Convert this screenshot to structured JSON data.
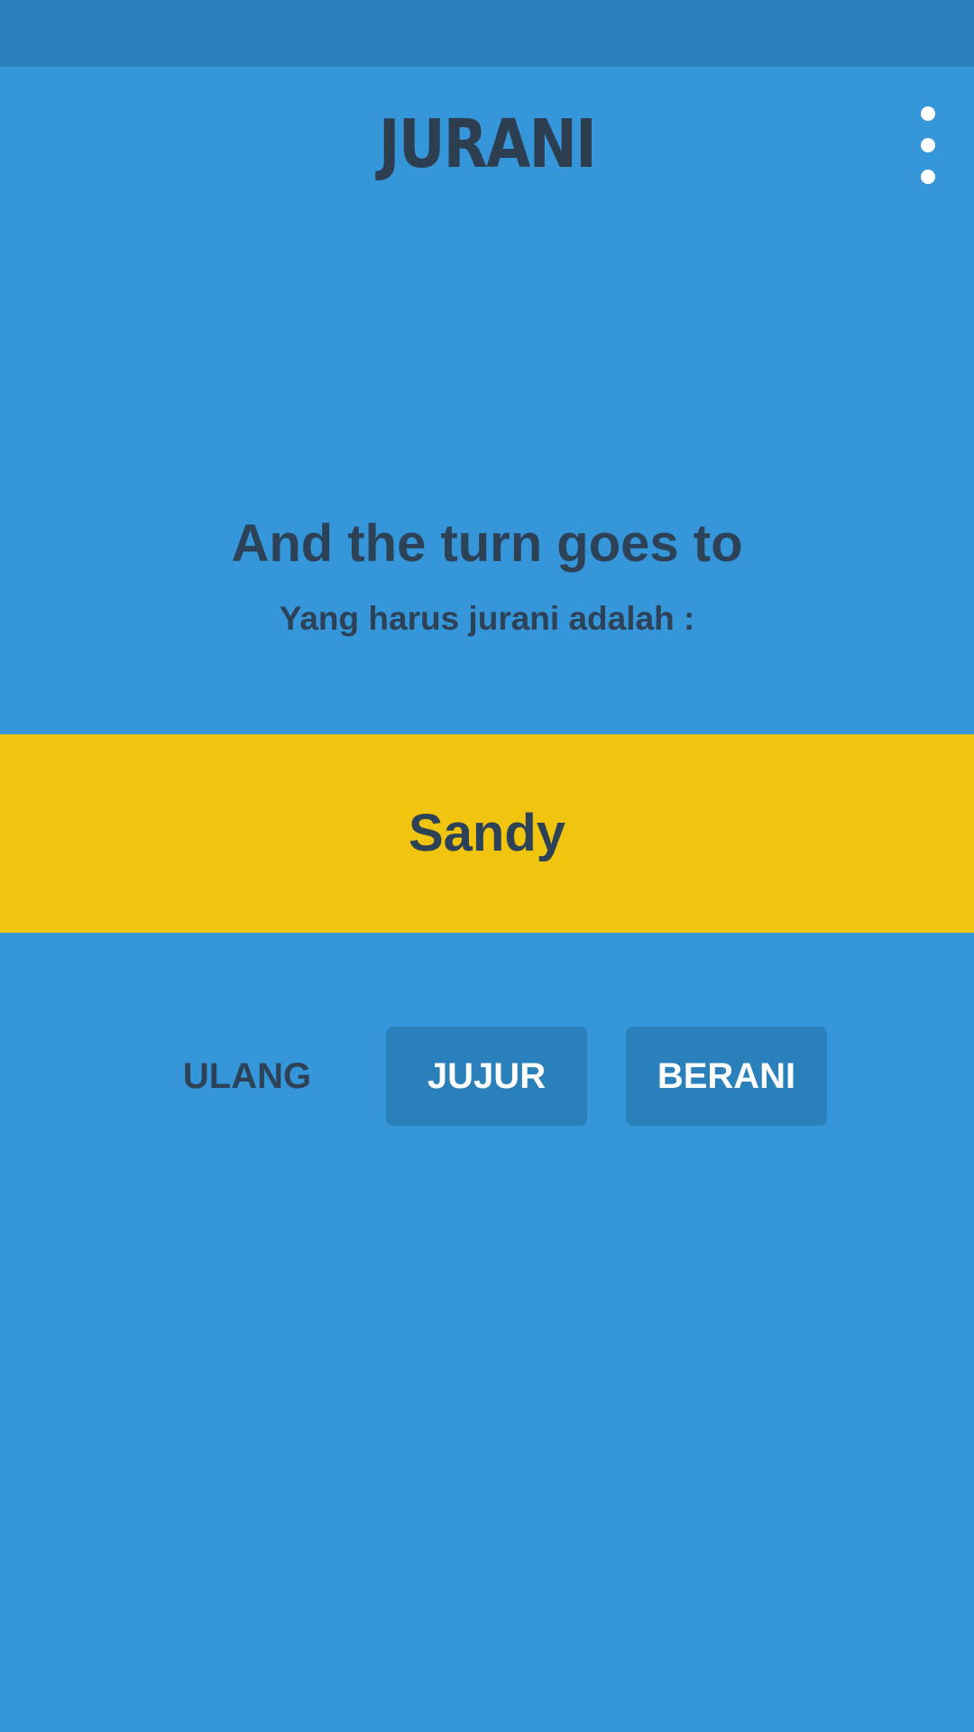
{
  "app": {
    "title": "JURANI",
    "menu_icon": "more-vert-icon"
  },
  "main": {
    "headline": "And the turn goes to",
    "subtitle": "Yang harus jurani adalah :",
    "player_name": "Sandy"
  },
  "actions": {
    "ulang_label": "ULANG",
    "jujur_label": "JUJUR",
    "berani_label": "BERANI"
  },
  "colors": {
    "background": "#3596DA",
    "status_bar": "#2A80BA",
    "banner": "#F1C40F",
    "button": "#2A80BA",
    "dark_text": "#2E4257",
    "button_text": "#FFFFFF"
  }
}
